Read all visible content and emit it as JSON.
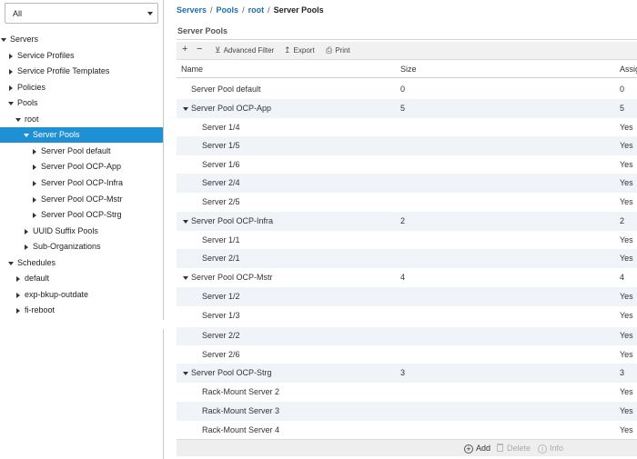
{
  "filter": {
    "value": "All"
  },
  "tree": [
    {
      "label": "Servers",
      "state": "open",
      "level": 0
    },
    {
      "label": "Service Profiles",
      "state": "closed",
      "level": 1
    },
    {
      "label": "Service Profile Templates",
      "state": "closed",
      "level": 1
    },
    {
      "label": "Policies",
      "state": "closed",
      "level": 1
    },
    {
      "label": "Pools",
      "state": "open",
      "level": 1
    },
    {
      "label": "root",
      "state": "open",
      "level": 2
    },
    {
      "label": "Server Pools",
      "state": "open",
      "level": 3,
      "selected": true
    },
    {
      "label": "Server Pool default",
      "state": "closed",
      "level": 4
    },
    {
      "label": "Server Pool OCP-App",
      "state": "closed",
      "level": 4
    },
    {
      "label": "Server Pool OCP-Infra",
      "state": "closed",
      "level": 4
    },
    {
      "label": "Server Pool OCP-Mstr",
      "state": "closed",
      "level": 4
    },
    {
      "label": "Server Pool OCP-Strg",
      "state": "closed",
      "level": 4
    },
    {
      "label": "UUID Suffix Pools",
      "state": "closed",
      "level": 3
    },
    {
      "label": "Sub-Organizations",
      "state": "closed",
      "level": 3
    },
    {
      "label": "Schedules",
      "state": "open",
      "level": 1
    },
    {
      "label": "default",
      "state": "closed",
      "level": 2
    },
    {
      "label": "exp-bkup-outdate",
      "state": "closed",
      "level": 2
    },
    {
      "label": "fi-reboot",
      "state": "closed",
      "level": 2
    }
  ],
  "breadcrumb": {
    "servers": "Servers",
    "pools": "Pools",
    "root": "root",
    "current": "Server Pools",
    "sep": "/"
  },
  "panel": {
    "title": "Server Pools"
  },
  "toolbar": {
    "add": "+",
    "remove": "−",
    "advanced_filter": "Advanced Filter",
    "export": "Export",
    "print": "Print"
  },
  "table": {
    "headers": {
      "name": "Name",
      "size": "Size",
      "assigned": "Assig"
    },
    "rows": [
      {
        "name": "Server Pool default",
        "size": "0",
        "assigned": "0",
        "type": "pool",
        "expanded": false
      },
      {
        "name": "Server Pool OCP-App",
        "size": "5",
        "assigned": "5",
        "type": "pool",
        "expanded": true
      },
      {
        "name": "Server 1/4",
        "size": "",
        "assigned": "Yes",
        "type": "member"
      },
      {
        "name": "Server 1/5",
        "size": "",
        "assigned": "Yes",
        "type": "member"
      },
      {
        "name": "Server 1/6",
        "size": "",
        "assigned": "Yes",
        "type": "member"
      },
      {
        "name": "Server 2/4",
        "size": "",
        "assigned": "Yes",
        "type": "member"
      },
      {
        "name": "Server 2/5",
        "size": "",
        "assigned": "Yes",
        "type": "member"
      },
      {
        "name": "Server Pool OCP-Infra",
        "size": "2",
        "assigned": "2",
        "type": "pool",
        "expanded": true
      },
      {
        "name": "Server 1/1",
        "size": "",
        "assigned": "Yes",
        "type": "member"
      },
      {
        "name": "Server 2/1",
        "size": "",
        "assigned": "Yes",
        "type": "member"
      },
      {
        "name": "Server Pool OCP-Mstr",
        "size": "4",
        "assigned": "4",
        "type": "pool",
        "expanded": true
      },
      {
        "name": "Server 1/2",
        "size": "",
        "assigned": "Yes",
        "type": "member"
      },
      {
        "name": "Server 1/3",
        "size": "",
        "assigned": "Yes",
        "type": "member"
      },
      {
        "name": "Server 2/2",
        "size": "",
        "assigned": "Yes",
        "type": "member"
      },
      {
        "name": "Server 2/6",
        "size": "",
        "assigned": "Yes",
        "type": "member"
      },
      {
        "name": "Server Pool OCP-Strg",
        "size": "3",
        "assigned": "3",
        "type": "pool",
        "expanded": true
      },
      {
        "name": "Rack-Mount Server 2",
        "size": "",
        "assigned": "Yes",
        "type": "member"
      },
      {
        "name": "Rack-Mount Server 3",
        "size": "",
        "assigned": "Yes",
        "type": "member"
      },
      {
        "name": "Rack-Mount Server 4",
        "size": "",
        "assigned": "Yes",
        "type": "member"
      }
    ]
  },
  "actions": {
    "add": "Add",
    "delete": "Delete",
    "info": "Info"
  },
  "colors": {
    "selected_bg": "#1f8fd6",
    "link": "#1b6fa8",
    "row_alt": "#f0f3f7"
  },
  "icons": {
    "add": "plus-circle-icon",
    "delete": "trash-icon",
    "info": "info-circle-icon",
    "filter": "filter-icon",
    "export": "export-icon",
    "print": "print-icon"
  }
}
